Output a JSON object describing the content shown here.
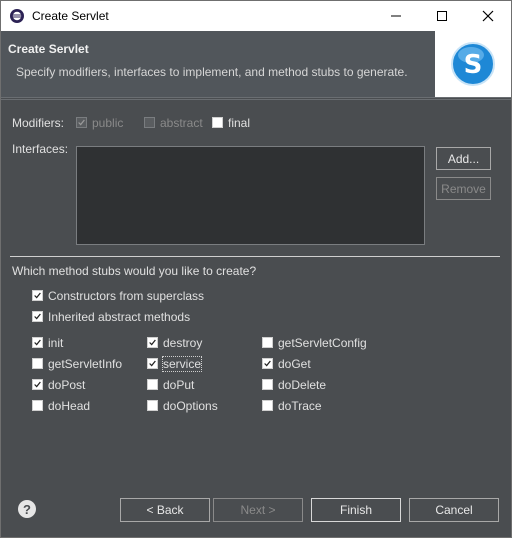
{
  "window": {
    "title": "Create Servlet"
  },
  "banner": {
    "title": "Create Servlet",
    "description": "Specify modifiers, interfaces to implement, and method stubs to generate."
  },
  "modifiers": {
    "label": "Modifiers:",
    "public": {
      "label": "public",
      "checked": true,
      "enabled": false
    },
    "abstract": {
      "label": "abstract",
      "checked": false,
      "enabled": false
    },
    "final": {
      "label": "final",
      "checked": false,
      "enabled": true
    }
  },
  "interfaces": {
    "label": "Interfaces:",
    "add_label": "Add...",
    "remove_label": "Remove"
  },
  "stubs": {
    "question": "Which method stubs would you like to create?",
    "constructors": {
      "label": "Constructors from superclass",
      "checked": true
    },
    "inherited": {
      "label": "Inherited abstract methods",
      "checked": true
    },
    "methods": [
      {
        "label": "init",
        "checked": true
      },
      {
        "label": "destroy",
        "checked": true
      },
      {
        "label": "getServletConfig",
        "checked": false
      },
      {
        "label": "getServletInfo",
        "checked": false
      },
      {
        "label": "service",
        "checked": true
      },
      {
        "label": "doGet",
        "checked": true
      },
      {
        "label": "doPost",
        "checked": true
      },
      {
        "label": "doPut",
        "checked": false
      },
      {
        "label": "doDelete",
        "checked": false
      },
      {
        "label": "doHead",
        "checked": false
      },
      {
        "label": "doOptions",
        "checked": false
      },
      {
        "label": "doTrace",
        "checked": false
      }
    ]
  },
  "footer": {
    "help_icon": "?",
    "back_label": "< Back",
    "next_label": "Next >",
    "finish_label": "Finish",
    "cancel_label": "Cancel"
  },
  "colors": {
    "background": "#4a4d50",
    "banner": "#51565b",
    "logo_blue": "#1e88d6"
  }
}
